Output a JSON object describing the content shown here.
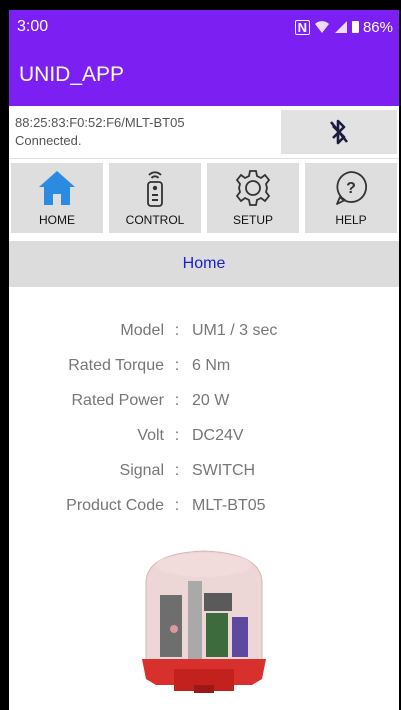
{
  "status_bar": {
    "time": "3:00",
    "battery": "86%",
    "icons": [
      "nfc-icon",
      "wifi-icon",
      "signal-icon",
      "battery-icon"
    ]
  },
  "app_bar": {
    "title": "UNID_APP",
    "color": "#7b1ff2"
  },
  "connection": {
    "address": "88:25:83:F0:52:F6/MLT-BT05",
    "status": "Connected.",
    "bluetooth_icon": "bluetooth-off-icon"
  },
  "nav": [
    {
      "label": "HOME",
      "icon": "home-icon"
    },
    {
      "label": "CONTROL",
      "icon": "remote-icon"
    },
    {
      "label": "SETUP",
      "icon": "gear-icon"
    },
    {
      "label": "HELP",
      "icon": "help-icon"
    }
  ],
  "section": {
    "title": "Home",
    "color": "#1b20c8"
  },
  "specs": [
    {
      "label": "Model",
      "value": "UM1 / 3 sec"
    },
    {
      "label": "Rated Torque",
      "value": "6 Nm"
    },
    {
      "label": "Rated Power",
      "value": "20 W"
    },
    {
      "label": "Volt",
      "value": "DC24V"
    },
    {
      "label": "Signal",
      "value": "SWITCH"
    },
    {
      "label": "Product Code",
      "value": "MLT-BT05"
    }
  ],
  "spec_separator": ":"
}
